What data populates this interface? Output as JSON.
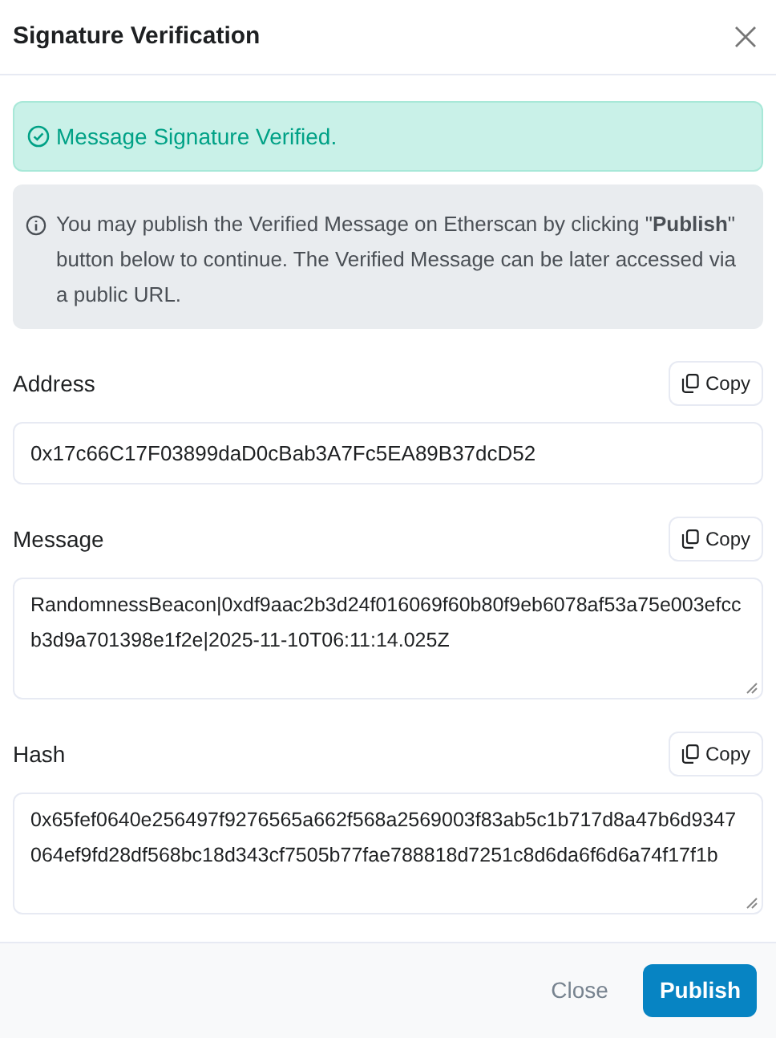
{
  "dialog": {
    "title": "Signature Verification"
  },
  "success_alert": {
    "text": "Message Signature Verified."
  },
  "info_alert": {
    "text": " You may publish the Verified Message on Etherscan by clicking \"**Publish**\" button below to continue. The Verified Message can be later accessed via a public URL."
  },
  "fields": [
    {
      "label": "Address",
      "copy": "Copy",
      "value": "0x17c66C17F03899daD0cBab3A7Fc5EA89B37dcD52",
      "kind": "input"
    },
    {
      "label": "Message",
      "copy": "Copy",
      "value": "RandomnessBeacon|0xdf9aac2b3d24f016069f60b80f9eb6078af53a75e003efccb3d9a701398e1f2e|2025-11-10T06:11:14.025Z",
      "kind": "textarea"
    },
    {
      "label": "Hash",
      "copy": "Copy",
      "value": "0x65fef0640e256497f9276565a662f568a2569003f83ab5c1b717d8a47b6d9347064ef9fd28df568bc18d343cf7505b77fae788818d7251c8d6da6f6d6a74f17f1b",
      "kind": "textarea"
    }
  ],
  "footer": {
    "buttons": [
      {
        "label": "Close",
        "kind": "secondary"
      },
      {
        "label": "Publish",
        "kind": "primary"
      }
    ]
  }
}
